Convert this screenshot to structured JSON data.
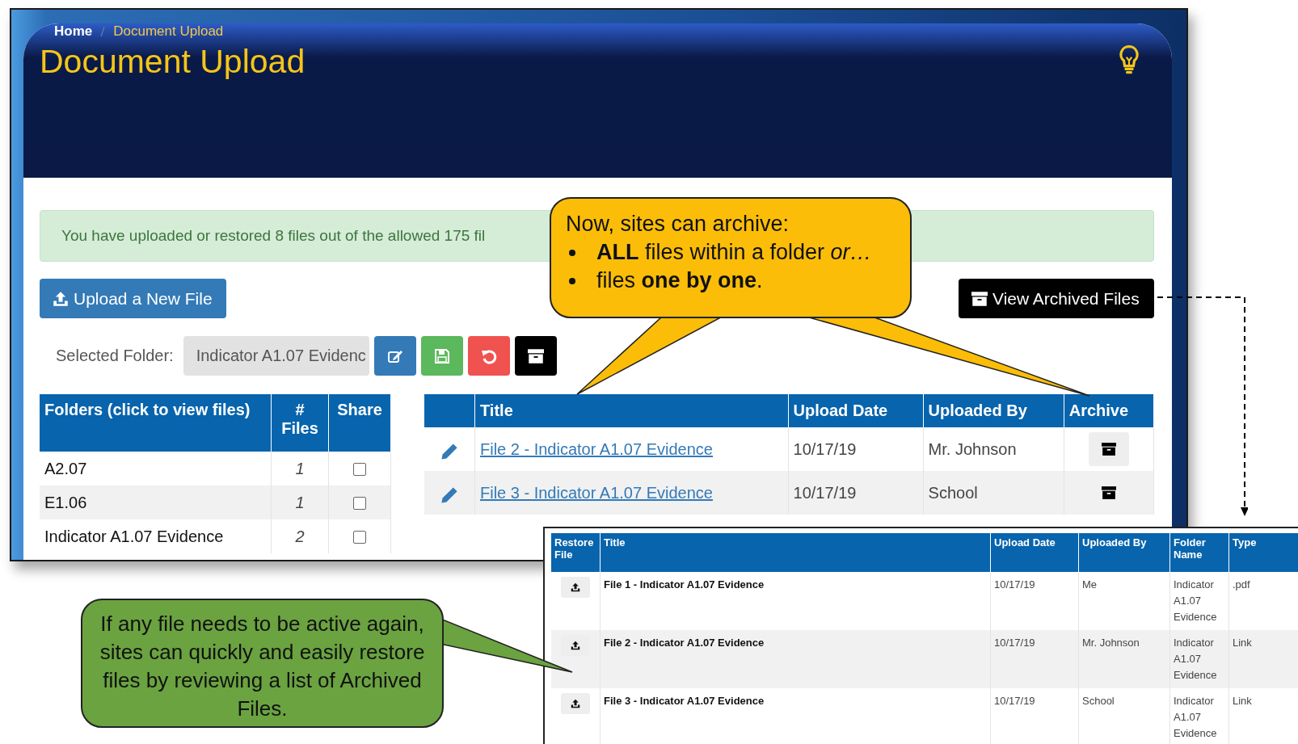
{
  "breadcrumb": [
    {
      "label": "Home",
      "selected": false
    },
    {
      "label": "Document Upload",
      "selected": true
    }
  ],
  "page_title": "Document Upload",
  "alert": "You have uploaded or restored 8 files out of the allowed 175 fil",
  "upload_button": "Upload a New File",
  "view_archived_button": "View Archived Files",
  "selected_folder": {
    "label": "Selected Folder:",
    "value": "Indicator A1.07 Evidenc"
  },
  "folder_actions": [
    {
      "kind": "edit"
    },
    {
      "kind": "save"
    },
    {
      "kind": "undo"
    },
    {
      "kind": "archive"
    }
  ],
  "folders_table": {
    "columns": [
      "Folders (click to view files)",
      "# Files",
      "Share"
    ],
    "rows": [
      {
        "name": "A2.07",
        "files": "1",
        "shared": false
      },
      {
        "name": "E1.06",
        "files": "1",
        "shared": false
      },
      {
        "name": "Indicator A1.07 Evidence",
        "files": "2",
        "shared": false
      }
    ]
  },
  "files_table": {
    "columns": [
      "Title",
      "Upload Date",
      "Uploaded By",
      "Archive"
    ],
    "rows": [
      {
        "title": "File 2 - Indicator A1.07 Evidence",
        "date": "10/17/19",
        "by": "Mr. Johnson"
      },
      {
        "title": "File 3 - Indicator A1.07 Evidence",
        "date": "10/17/19",
        "by": "School"
      }
    ]
  },
  "archived_table": {
    "columns": [
      "Restore File",
      "Title",
      "Upload Date",
      "Uploaded By",
      "Folder Name",
      "Type"
    ],
    "rows": [
      {
        "title": "File 1 - Indicator A1.07 Evidence",
        "date": "10/17/19",
        "by": "Me",
        "folder": "Indicator A1.07 Evidence",
        "type": ".pdf"
      },
      {
        "title": "File 2 - Indicator A1.07 Evidence",
        "date": "10/17/19",
        "by": "Mr. Johnson",
        "folder": "Indicator A1.07 Evidence",
        "type": "Link"
      },
      {
        "title": "File 3 - Indicator A1.07 Evidence",
        "date": "10/17/19",
        "by": "School",
        "folder": "Indicator A1.07 Evidence",
        "type": "Link"
      }
    ]
  },
  "callouts": [
    {
      "kind": "archive-note",
      "heading": "Now, sites can archive:",
      "bullets": [
        "**ALL** files within a folder *or…*",
        "files **one by one**."
      ]
    },
    {
      "kind": "restore-note",
      "text": "If any file needs to be active again, sites can quickly and easily restore files by reviewing a list of Archived Files."
    }
  ]
}
